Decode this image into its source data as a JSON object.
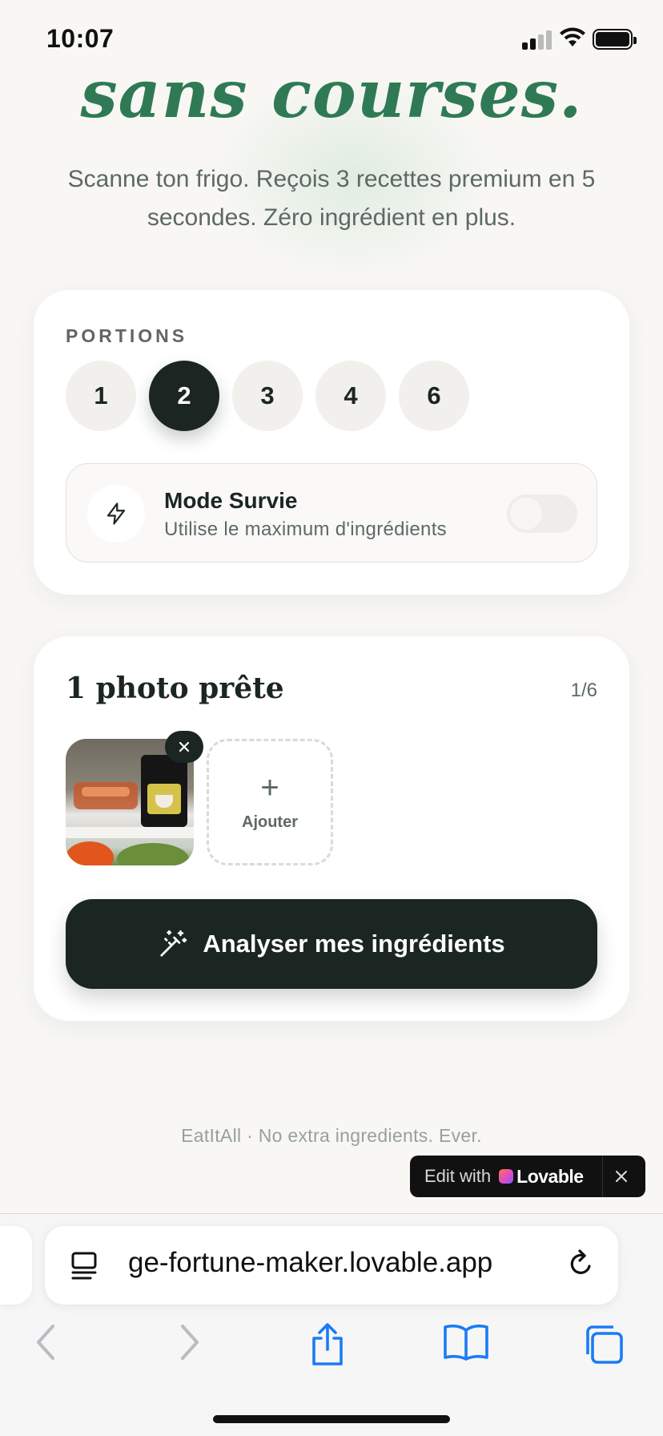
{
  "status_bar": {
    "time": "10:07"
  },
  "hero": {
    "headline": "sans courses.",
    "subtitle": "Scanne ton frigo. Reçois 3 recettes premium en 5 secondes. Zéro ingrédient en plus."
  },
  "settings_card": {
    "portions_label": "PORTIONS",
    "portions": [
      "1",
      "2",
      "3",
      "4",
      "6"
    ],
    "selected_portion": "2",
    "mode": {
      "title": "Mode Survie",
      "description": "Utilise le maximum d'ingrédients",
      "enabled": false
    }
  },
  "photos_card": {
    "title": "1 photo prête",
    "count": "1/6",
    "add_label": "Ajouter",
    "analyse_label": "Analyser mes ingrédients"
  },
  "footer": {
    "tagline": "EatItAll · No extra ingredients. Ever."
  },
  "lovable_badge": {
    "edit_label": "Edit with",
    "brand": "Lovable"
  },
  "browser": {
    "url": "ge-fortune-maker.lovable.app"
  },
  "colors": {
    "accent_green": "#2f7a55",
    "dark": "#1b2623",
    "background": "#f8f7f4",
    "ios_blue": "#1a7cf5"
  }
}
